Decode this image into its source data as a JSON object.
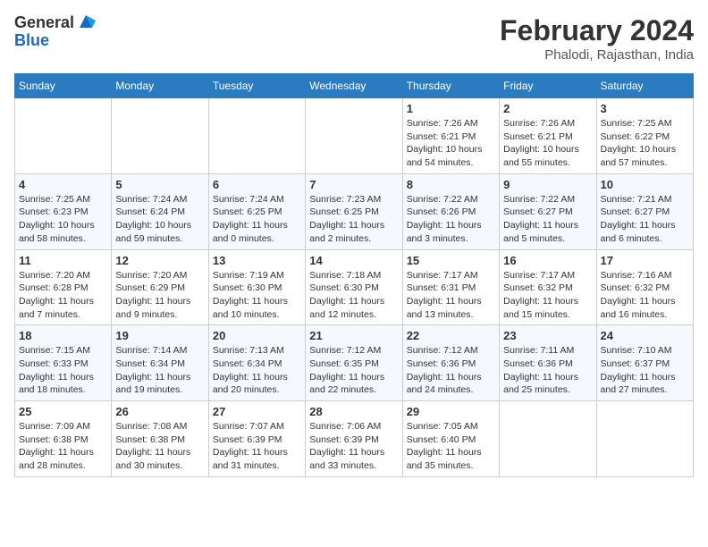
{
  "logo": {
    "general": "General",
    "blue": "Blue"
  },
  "header": {
    "month_year": "February 2024",
    "location": "Phalodi, Rajasthan, India"
  },
  "days_of_week": [
    "Sunday",
    "Monday",
    "Tuesday",
    "Wednesday",
    "Thursday",
    "Friday",
    "Saturday"
  ],
  "weeks": [
    [
      {
        "day": "",
        "info": ""
      },
      {
        "day": "",
        "info": ""
      },
      {
        "day": "",
        "info": ""
      },
      {
        "day": "",
        "info": ""
      },
      {
        "day": "1",
        "info": "Sunrise: 7:26 AM\nSunset: 6:21 PM\nDaylight: 10 hours\nand 54 minutes."
      },
      {
        "day": "2",
        "info": "Sunrise: 7:26 AM\nSunset: 6:21 PM\nDaylight: 10 hours\nand 55 minutes."
      },
      {
        "day": "3",
        "info": "Sunrise: 7:25 AM\nSunset: 6:22 PM\nDaylight: 10 hours\nand 57 minutes."
      }
    ],
    [
      {
        "day": "4",
        "info": "Sunrise: 7:25 AM\nSunset: 6:23 PM\nDaylight: 10 hours\nand 58 minutes."
      },
      {
        "day": "5",
        "info": "Sunrise: 7:24 AM\nSunset: 6:24 PM\nDaylight: 10 hours\nand 59 minutes."
      },
      {
        "day": "6",
        "info": "Sunrise: 7:24 AM\nSunset: 6:25 PM\nDaylight: 11 hours\nand 0 minutes."
      },
      {
        "day": "7",
        "info": "Sunrise: 7:23 AM\nSunset: 6:25 PM\nDaylight: 11 hours\nand 2 minutes."
      },
      {
        "day": "8",
        "info": "Sunrise: 7:22 AM\nSunset: 6:26 PM\nDaylight: 11 hours\nand 3 minutes."
      },
      {
        "day": "9",
        "info": "Sunrise: 7:22 AM\nSunset: 6:27 PM\nDaylight: 11 hours\nand 5 minutes."
      },
      {
        "day": "10",
        "info": "Sunrise: 7:21 AM\nSunset: 6:27 PM\nDaylight: 11 hours\nand 6 minutes."
      }
    ],
    [
      {
        "day": "11",
        "info": "Sunrise: 7:20 AM\nSunset: 6:28 PM\nDaylight: 11 hours\nand 7 minutes."
      },
      {
        "day": "12",
        "info": "Sunrise: 7:20 AM\nSunset: 6:29 PM\nDaylight: 11 hours\nand 9 minutes."
      },
      {
        "day": "13",
        "info": "Sunrise: 7:19 AM\nSunset: 6:30 PM\nDaylight: 11 hours\nand 10 minutes."
      },
      {
        "day": "14",
        "info": "Sunrise: 7:18 AM\nSunset: 6:30 PM\nDaylight: 11 hours\nand 12 minutes."
      },
      {
        "day": "15",
        "info": "Sunrise: 7:17 AM\nSunset: 6:31 PM\nDaylight: 11 hours\nand 13 minutes."
      },
      {
        "day": "16",
        "info": "Sunrise: 7:17 AM\nSunset: 6:32 PM\nDaylight: 11 hours\nand 15 minutes."
      },
      {
        "day": "17",
        "info": "Sunrise: 7:16 AM\nSunset: 6:32 PM\nDaylight: 11 hours\nand 16 minutes."
      }
    ],
    [
      {
        "day": "18",
        "info": "Sunrise: 7:15 AM\nSunset: 6:33 PM\nDaylight: 11 hours\nand 18 minutes."
      },
      {
        "day": "19",
        "info": "Sunrise: 7:14 AM\nSunset: 6:34 PM\nDaylight: 11 hours\nand 19 minutes."
      },
      {
        "day": "20",
        "info": "Sunrise: 7:13 AM\nSunset: 6:34 PM\nDaylight: 11 hours\nand 20 minutes."
      },
      {
        "day": "21",
        "info": "Sunrise: 7:12 AM\nSunset: 6:35 PM\nDaylight: 11 hours\nand 22 minutes."
      },
      {
        "day": "22",
        "info": "Sunrise: 7:12 AM\nSunset: 6:36 PM\nDaylight: 11 hours\nand 24 minutes."
      },
      {
        "day": "23",
        "info": "Sunrise: 7:11 AM\nSunset: 6:36 PM\nDaylight: 11 hours\nand 25 minutes."
      },
      {
        "day": "24",
        "info": "Sunrise: 7:10 AM\nSunset: 6:37 PM\nDaylight: 11 hours\nand 27 minutes."
      }
    ],
    [
      {
        "day": "25",
        "info": "Sunrise: 7:09 AM\nSunset: 6:38 PM\nDaylight: 11 hours\nand 28 minutes."
      },
      {
        "day": "26",
        "info": "Sunrise: 7:08 AM\nSunset: 6:38 PM\nDaylight: 11 hours\nand 30 minutes."
      },
      {
        "day": "27",
        "info": "Sunrise: 7:07 AM\nSunset: 6:39 PM\nDaylight: 11 hours\nand 31 minutes."
      },
      {
        "day": "28",
        "info": "Sunrise: 7:06 AM\nSunset: 6:39 PM\nDaylight: 11 hours\nand 33 minutes."
      },
      {
        "day": "29",
        "info": "Sunrise: 7:05 AM\nSunset: 6:40 PM\nDaylight: 11 hours\nand 35 minutes."
      },
      {
        "day": "",
        "info": ""
      },
      {
        "day": "",
        "info": ""
      }
    ]
  ]
}
